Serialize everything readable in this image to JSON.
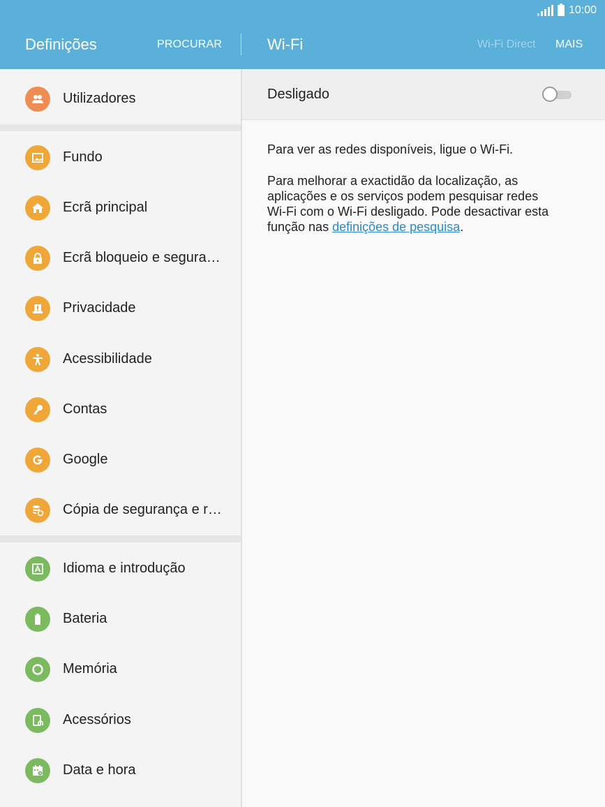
{
  "status_bar": {
    "time": "10:00"
  },
  "app_bar": {
    "left_title": "Definições",
    "search_label": "PROCURAR",
    "right_title": "Wi-Fi",
    "wifi_direct_label": "Wi-Fi Direct",
    "more_label": "MAIS"
  },
  "sidebar": {
    "groups": [
      [
        {
          "label": "Utilizadores",
          "icon": "users-icon",
          "color": "#ef8c54"
        }
      ],
      [
        {
          "label": "Fundo",
          "icon": "wallpaper-icon",
          "color": "#f0a73a"
        },
        {
          "label": "Ecrã principal",
          "icon": "home-icon",
          "color": "#f0a73a"
        },
        {
          "label": "Ecrã bloqueio e segura…",
          "icon": "lock-icon",
          "color": "#f0a73a"
        },
        {
          "label": "Privacidade",
          "icon": "privacy-icon",
          "color": "#f0a73a"
        },
        {
          "label": "Acessibilidade",
          "icon": "accessibility-icon",
          "color": "#f0a73a"
        },
        {
          "label": "Contas",
          "icon": "key-icon",
          "color": "#f0a73a"
        },
        {
          "label": "Google",
          "icon": "google-icon",
          "color": "#f0a73a"
        },
        {
          "label": "Cópia de segurança e r…",
          "icon": "backup-icon",
          "color": "#f0a73a"
        }
      ],
      [
        {
          "label": "Idioma e introdução",
          "icon": "language-icon",
          "color": "#7cba60"
        },
        {
          "label": "Bateria",
          "icon": "battery-icon",
          "color": "#7cba60"
        },
        {
          "label": "Memória",
          "icon": "memory-icon",
          "color": "#7cba60"
        },
        {
          "label": "Acessórios",
          "icon": "accessories-icon",
          "color": "#7cba60"
        },
        {
          "label": "Data e hora",
          "icon": "calendar-icon",
          "color": "#7cba60"
        }
      ]
    ]
  },
  "content": {
    "toggle_label": "Desligado",
    "toggle_on": false,
    "para1": "Para ver as redes disponíveis, ligue o Wi-Fi.",
    "para2_line1": "Para melhorar a exactidão da localização, as",
    "para2_line2": "aplicações e os serviços podem pesquisar redes",
    "para2_line3": "Wi-Fi com o Wi-Fi desligado. Pode desactivar esta",
    "para2_prefix": "função nas ",
    "para2_link": "definições de pesquisa",
    "para2_suffix": "."
  },
  "colors": {
    "header": "#5ab0d8",
    "orange_user": "#ef8c54",
    "orange": "#f0a73a",
    "green": "#7cba60",
    "link": "#2a8acb"
  }
}
